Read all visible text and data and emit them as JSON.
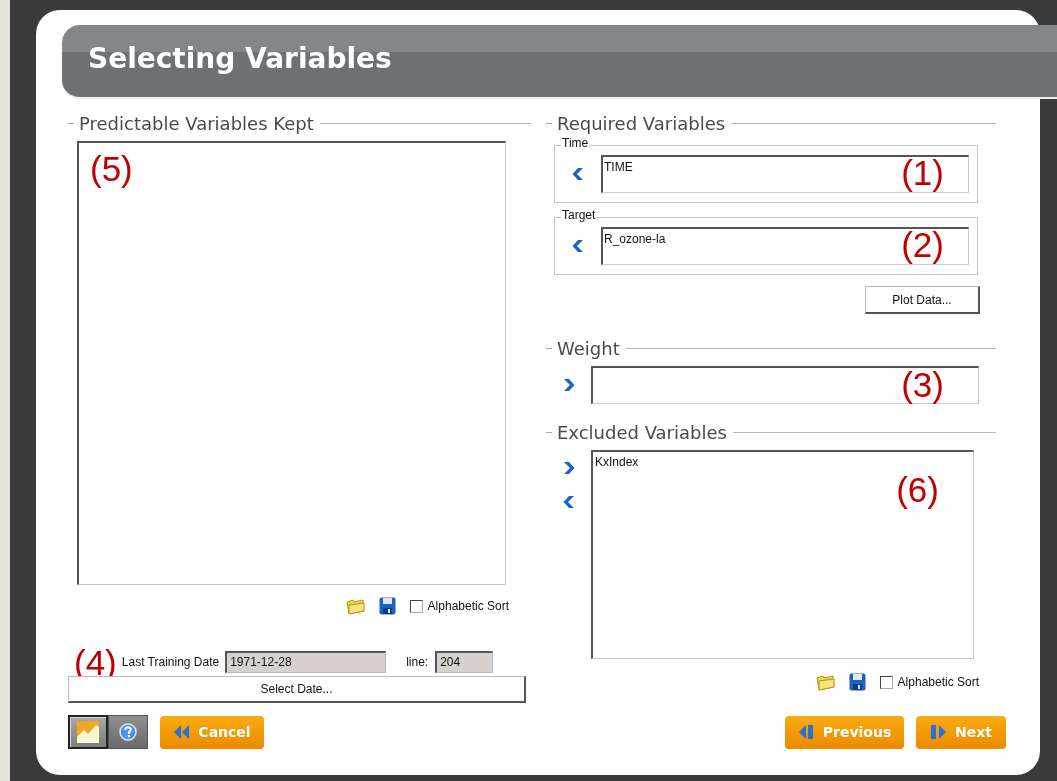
{
  "title": "Selecting Variables",
  "kept": {
    "title": "Predictable Variables Kept",
    "annotation": "(5)",
    "alphabetic_sort": {
      "label": "Alphabetic Sort",
      "checked": false
    }
  },
  "training": {
    "annotation": "(4)",
    "label": "Last Training Date",
    "date": "1971-12-28",
    "line_label": "line:",
    "line": "204",
    "button": "Select Date..."
  },
  "required": {
    "title": "Required Variables",
    "groups": [
      {
        "legend": "Time",
        "value": "TIME",
        "annotation": "(1)"
      },
      {
        "legend": "Target",
        "value": "R_ozone-la",
        "annotation": "(2)"
      }
    ],
    "button": "Plot Data..."
  },
  "weight": {
    "title": "Weight",
    "annotation": "(3)"
  },
  "excluded": {
    "title": "Excluded Variables",
    "items": [
      "KxIndex"
    ],
    "annotation": "(6)",
    "alphabetic_sort": {
      "label": "Alphabetic Sort",
      "checked": false
    }
  },
  "footer": {
    "mode_buttons": [
      {
        "kind": "chart",
        "selected": true
      },
      {
        "kind": "help",
        "selected": false
      }
    ],
    "cancel": "Cancel",
    "previous": "Previous",
    "next": "Next"
  }
}
